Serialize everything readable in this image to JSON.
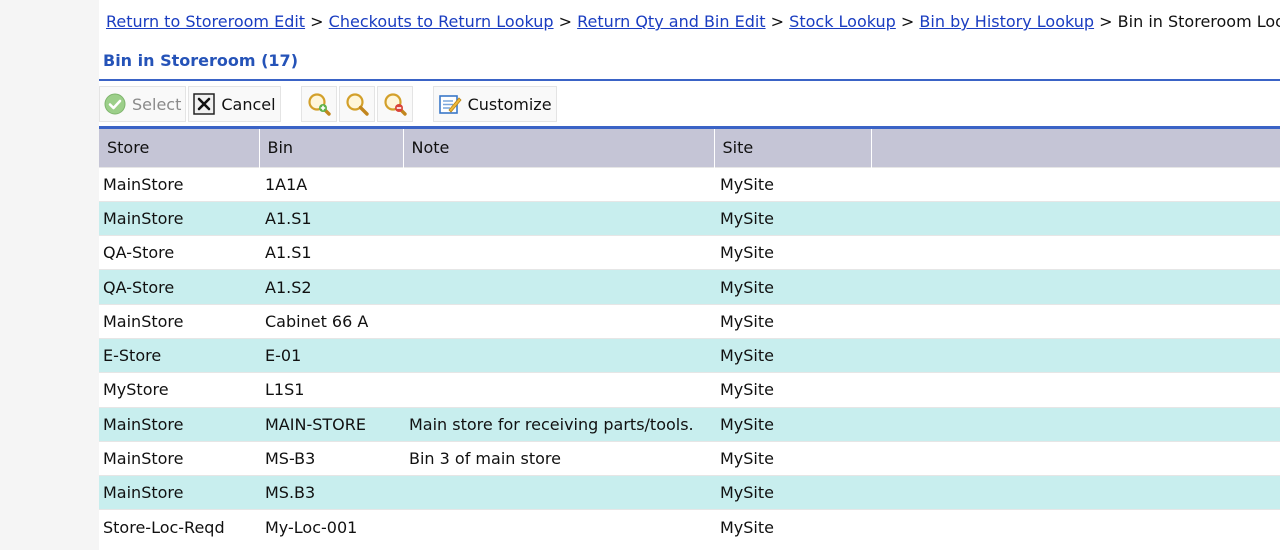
{
  "breadcrumb": {
    "links": [
      "Return to Storeroom Edit",
      "Checkouts to Return Lookup",
      "Return Qty and Bin Edit",
      "Stock Lookup",
      "Bin by History Lookup"
    ],
    "separator": ">",
    "current": "Bin in Storeroom Lookup"
  },
  "page_title": "Bin in Storeroom (17)",
  "toolbar": {
    "select_label": "Select",
    "cancel_label": "Cancel",
    "customize_label": "Customize",
    "icons": [
      "check-circle-icon",
      "close-box-icon",
      "zoom-in-icon",
      "search-icon",
      "zoom-out-icon",
      "customize-icon"
    ]
  },
  "grid": {
    "columns": [
      "Store",
      "Bin",
      "Note",
      "Site"
    ],
    "rows": [
      {
        "store": "MainStore",
        "bin": "1A1A",
        "note": "",
        "site": "MySite"
      },
      {
        "store": "MainStore",
        "bin": "A1.S1",
        "note": "",
        "site": "MySite"
      },
      {
        "store": "QA-Store",
        "bin": "A1.S1",
        "note": "",
        "site": "MySite"
      },
      {
        "store": "QA-Store",
        "bin": "A1.S2",
        "note": "",
        "site": "MySite"
      },
      {
        "store": "MainStore",
        "bin": "Cabinet 66 A",
        "note": "",
        "site": "MySite"
      },
      {
        "store": "E-Store",
        "bin": "E-01",
        "note": "",
        "site": "MySite"
      },
      {
        "store": "MyStore",
        "bin": "L1S1",
        "note": "",
        "site": "MySite"
      },
      {
        "store": "MainStore",
        "bin": "MAIN-STORE",
        "note": "Main store for receiving parts/tools.",
        "site": "MySite"
      },
      {
        "store": "MainStore",
        "bin": "MS-B3",
        "note": "Bin 3 of main store",
        "site": "MySite"
      },
      {
        "store": "MainStore",
        "bin": "MS.B3",
        "note": "",
        "site": "MySite"
      },
      {
        "store": "Store-Loc-Reqd",
        "bin": "My-Loc-001",
        "note": "",
        "site": "MySite"
      }
    ]
  },
  "colors": {
    "link": "#1a3dc1",
    "title": "#2553b8",
    "rule": "#3a63c6",
    "header_bg": "#c5c5d6",
    "alt_row": "#c8eeee"
  }
}
